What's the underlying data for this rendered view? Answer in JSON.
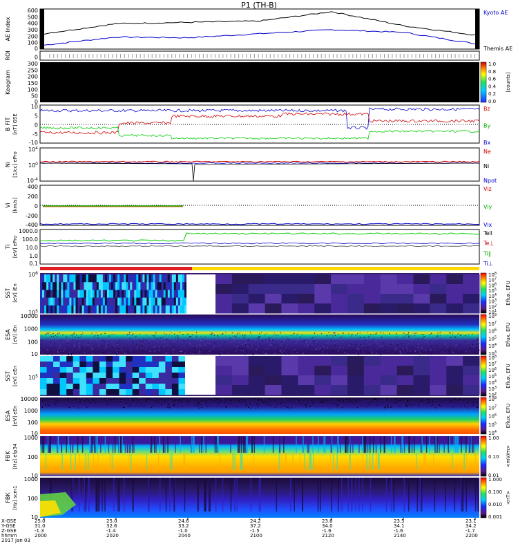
{
  "title": "P1 (TH-B)",
  "panels": [
    {
      "id": "ae",
      "ylabel": "AE Index",
      "yunit": "",
      "ticks": [
        "600",
        "500",
        "400",
        "300",
        "200",
        "100",
        "0"
      ],
      "right_labels": [
        {
          "text": "Kyoto AE",
          "color": "#0000cc"
        },
        {
          "text": "Themis AE",
          "color": "#000000"
        }
      ]
    },
    {
      "id": "roi",
      "ylabel": "ROI",
      "yunit": "",
      "ticks": [
        "0"
      ],
      "right_labels": []
    },
    {
      "id": "keogram",
      "ylabel": "Keogram",
      "yunit": "",
      "ticks": [
        "300",
        "250",
        "200",
        "150",
        "100",
        "50",
        "0"
      ],
      "colorbar": {
        "ticks": [
          "1.0",
          "0.8",
          "0.6",
          "0.4",
          "0.2",
          "0.0"
        ],
        "label": "[counts]"
      }
    },
    {
      "id": "bfield",
      "ylabel": "B FIT",
      "yunit": "[nT] GSE",
      "ticks": [
        "10",
        "5",
        "0",
        "-5",
        "-10"
      ],
      "right_labels": [
        {
          "text": "Bz",
          "color": "#cc0000"
        },
        {
          "text": "By",
          "color": "#00aa00"
        },
        {
          "text": "Bx",
          "color": "#0000cc"
        }
      ]
    },
    {
      "id": "density",
      "ylabel": "Ni",
      "yunit": "[1/cc] ePro",
      "ticks": [
        "10^4",
        "10^0",
        "10^-4"
      ],
      "right_labels": [
        {
          "text": "Ne",
          "color": "#cc0000"
        },
        {
          "text": "Ni",
          "color": "#000000"
        },
        {
          "text": "Npot",
          "color": "#0000cc"
        }
      ]
    },
    {
      "id": "velocity",
      "ylabel": "Vi",
      "yunit": "[km/s]",
      "ticks": [
        "400",
        "200",
        "0",
        "-200",
        "-400"
      ],
      "right_labels": [
        {
          "text": "Viz",
          "color": "#cc0000"
        },
        {
          "text": "Viy",
          "color": "#00aa00"
        },
        {
          "text": "Vix",
          "color": "#0000cc"
        }
      ]
    },
    {
      "id": "temperature",
      "ylabel": "Ti",
      "yunit": "[eV] ePro",
      "ticks": [
        "1000.0",
        "100.0",
        "10.0",
        "1.0",
        "0.1"
      ],
      "right_labels": [
        {
          "text": "Tell",
          "color": "#000000"
        },
        {
          "text": "Te⊥",
          "color": "#cc0000"
        },
        {
          "text": "Ti‖",
          "color": "#00aa00"
        },
        {
          "text": "Ti⊥",
          "color": "#0000cc"
        }
      ]
    },
    {
      "id": "sst_i",
      "ylabel": "SST",
      "yunit": "[eV] iEn",
      "ticks": [
        "10^6",
        "10^5"
      ],
      "colorbar": {
        "ticks": [
          "10^8",
          "10^7",
          "10^6",
          "10^5",
          "10^4",
          "10^3",
          "10^2",
          "10^1"
        ],
        "label": "Eflux, EFU"
      }
    },
    {
      "id": "esa_i",
      "ylabel": "ESA",
      "yunit": "[eV] iEn",
      "ticks": [
        "10000",
        "1000",
        "100",
        "10"
      ],
      "colorbar": {
        "ticks": [
          "10^8",
          "10^7",
          "10^6",
          "10^5",
          "10^4",
          "10^3"
        ],
        "label": "Eflux, EFU"
      }
    },
    {
      "id": "sst_e",
      "ylabel": "SST",
      "yunit": "[eV] eEn",
      "ticks": [
        "10^5"
      ],
      "colorbar": {
        "ticks": [
          "10^8",
          "10^7",
          "10^6",
          "10^5",
          "10^4",
          "10^3",
          "10^2"
        ],
        "label": "Eflux, EFU"
      }
    },
    {
      "id": "esa_e",
      "ylabel": "ESA",
      "yunit": "[eV] eEn",
      "ticks": [
        "10000",
        "1000",
        "100",
        "10"
      ],
      "colorbar": {
        "ticks": [
          "10^8",
          "10^7",
          "10^6",
          "10^5",
          "10^4"
        ],
        "label": "Eflux, EFU"
      }
    },
    {
      "id": "fbk_e",
      "ylabel": "FBK",
      "yunit": "[Hz] efp34",
      "ticks": [
        "1000",
        "100",
        "10"
      ],
      "colorbar": {
        "ticks": [
          "1.00",
          "0.10",
          "0.01"
        ],
        "label": "<mV/m>"
      }
    },
    {
      "id": "fbk_b",
      "ylabel": "FBK",
      "yunit": "[Hz] scm1",
      "ticks": [
        "1000",
        "100",
        "10"
      ],
      "colorbar": {
        "ticks": [
          "1.000",
          "0.100",
          "0.010",
          "0.001"
        ],
        "label": "<nT>"
      }
    }
  ],
  "xaxis": {
    "row_labels": [
      "X-GSE",
      "Y-GSE",
      "Z-GSE",
      "hhmm",
      "2017 Jan 03"
    ],
    "columns": [
      {
        "x": "25.0",
        "y": "31.0",
        "z": "-1.3",
        "t": "2000"
      },
      {
        "x": "25.0",
        "y": "32.6",
        "z": "-1.4",
        "t": "2020"
      },
      {
        "x": "24.6",
        "y": "33.2",
        "z": "-1.0",
        "t": "2040"
      },
      {
        "x": "24.2",
        "y": "37.2",
        "z": "-1.5",
        "t": "2100"
      },
      {
        "x": "23.8",
        "y": "34.0",
        "z": "-1.6",
        "t": "2120"
      },
      {
        "x": "23.5",
        "y": "34.1",
        "z": "-1.6",
        "t": "2140"
      },
      {
        "x": "23.1",
        "y": "34.2",
        "z": "-1.7",
        "t": "2200"
      }
    ]
  },
  "chart_data": {
    "type": "line",
    "x": [
      "2000",
      "2020",
      "2040",
      "2100",
      "2120",
      "2140",
      "2200"
    ],
    "series": [
      {
        "name": "Kyoto AE",
        "values": [
          60,
          180,
          170,
          230,
          290,
          250,
          80
        ]
      },
      {
        "name": "Themis AE",
        "values": [
          230,
          380,
          400,
          420,
          560,
          350,
          210
        ]
      }
    ],
    "ylim": [
      0,
      600
    ]
  },
  "colors": {
    "bz": "#cc0000",
    "by": "#00cc00",
    "bx": "#0000cc",
    "bar_red": "#e02020",
    "bar_yellow": "#ffd800"
  }
}
